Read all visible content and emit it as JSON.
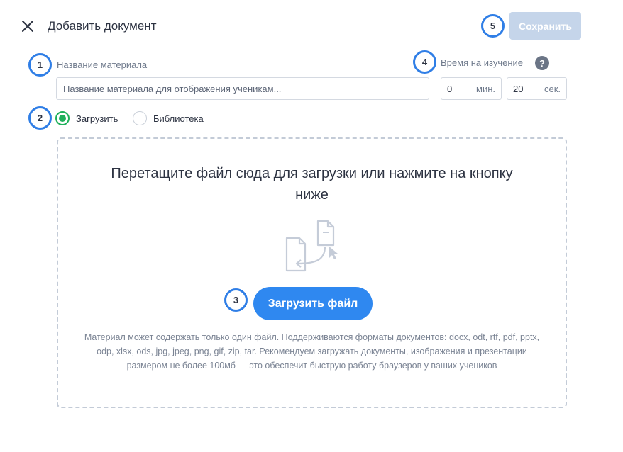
{
  "header": {
    "title": "Добавить документ",
    "save_label": "Сохранить",
    "close_icon": "close-icon"
  },
  "badges": [
    "1",
    "2",
    "3",
    "4",
    "5"
  ],
  "material": {
    "label": "Название материала",
    "placeholder": "Название материала для отображения ученикам..."
  },
  "study_time": {
    "label": "Время на изучение",
    "help_glyph": "?",
    "minutes_value": "0",
    "minutes_unit": "мин.",
    "seconds_value": "20",
    "seconds_unit": "сек."
  },
  "source": {
    "options": [
      {
        "label": "Загрузить",
        "checked": true
      },
      {
        "label": "Библиотека",
        "checked": false
      }
    ]
  },
  "dropzone": {
    "title": "Перетащите файл сюда для загрузки или нажмите на кнопку ниже",
    "button_label": "Загрузить файл",
    "hint": "Материал может содержать только один файл. Поддерживаются форматы документов: docx, odt, rtf, pdf, pptx, odp, xlsx, ods, jpg, jpeg, png, gif, zip, tar. Рекомендуем загружать документы, изображения и презентации размером не более 100мб — это обеспечит быструю работу браузеров у ваших учеников",
    "illustration_icon": "file-upload-icon"
  },
  "colors": {
    "accent": "#2f88f0",
    "badge_border": "#2f7ee6",
    "save_disabled": "#c5d5ea",
    "radio_checked": "#1fb05b"
  }
}
